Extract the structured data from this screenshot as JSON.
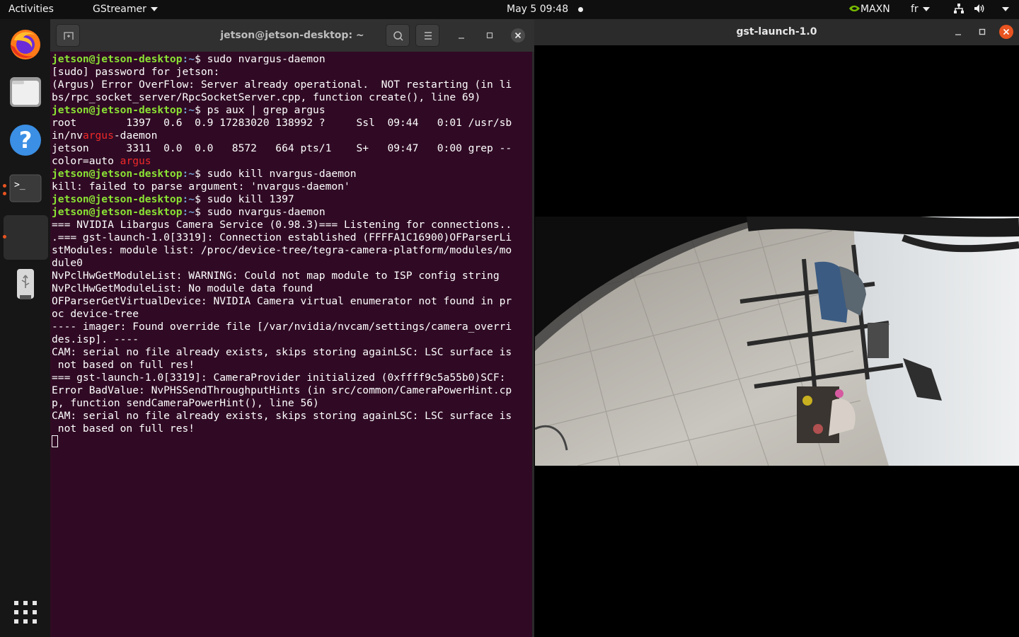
{
  "topbar": {
    "activities": "Activities",
    "app_menu": "GStreamer",
    "clock": "May 5  09:48",
    "power_mode": "MAXN",
    "keyboard_layout": "fr"
  },
  "dock": {
    "apps": [
      {
        "name": "Firefox",
        "icon": "firefox-icon"
      },
      {
        "name": "Files",
        "icon": "files-icon"
      },
      {
        "name": "Help",
        "icon": "help-icon"
      },
      {
        "name": "Terminal",
        "icon": "terminal-icon"
      },
      {
        "name": "GStreamer",
        "icon": "blank-app-icon"
      },
      {
        "name": "USB drive",
        "icon": "usb-drive-icon"
      }
    ],
    "show_apps_icon": "app-grid-icon"
  },
  "terminal": {
    "title": "jetson@jetson-desktop: ~",
    "prompt_user": "jetson@jetson-desktop",
    "prompt_path": ":~",
    "prompt_symbol": "$ ",
    "lines": [
      {
        "kind": "cmd",
        "text": "sudo nvargus-daemon"
      },
      {
        "kind": "out",
        "text": "[sudo] password for jetson:"
      },
      {
        "kind": "out",
        "text": "(Argus) Error OverFlow: Server already operational.  NOT restarting (in li"
      },
      {
        "kind": "out",
        "text": "bs/rpc_socket_server/RpcSocketServer.cpp, function create(), line 69)"
      },
      {
        "kind": "cmd",
        "text": "ps aux | grep argus"
      },
      {
        "kind": "out",
        "text": "root        1397  0.6  0.9 17283020 138992 ?     Ssl  09:44   0:01 /usr/sb"
      },
      {
        "kind": "hl",
        "pre": "in/nv",
        "hl": "argus",
        "post": "-daemon"
      },
      {
        "kind": "out",
        "text": "jetson      3311  0.0  0.0   8572   664 pts/1    S+   09:47   0:00 grep --"
      },
      {
        "kind": "hl",
        "pre": "color=auto ",
        "hl": "argus",
        "post": ""
      },
      {
        "kind": "cmd",
        "text": "sudo kill nvargus-daemon"
      },
      {
        "kind": "out",
        "text": "kill: failed to parse argument: 'nvargus-daemon'"
      },
      {
        "kind": "cmd",
        "text": "sudo kill 1397"
      },
      {
        "kind": "cmd",
        "text": "sudo nvargus-daemon"
      },
      {
        "kind": "out",
        "text": "=== NVIDIA Libargus Camera Service (0.98.3)=== Listening for connections.."
      },
      {
        "kind": "out",
        "text": ".=== gst-launch-1.0[3319]: Connection established (FFFFA1C16900)OFParserLi"
      },
      {
        "kind": "out",
        "text": "stModules: module list: /proc/device-tree/tegra-camera-platform/modules/mo"
      },
      {
        "kind": "out",
        "text": "dule0"
      },
      {
        "kind": "out",
        "text": "NvPclHwGetModuleList: WARNING: Could not map module to ISP config string"
      },
      {
        "kind": "out",
        "text": "NvPclHwGetModuleList: No module data found"
      },
      {
        "kind": "out",
        "text": "OFParserGetVirtualDevice: NVIDIA Camera virtual enumerator not found in pr"
      },
      {
        "kind": "out",
        "text": "oc device-tree"
      },
      {
        "kind": "out",
        "text": "---- imager: Found override file [/var/nvidia/nvcam/settings/camera_overri"
      },
      {
        "kind": "out",
        "text": "des.isp]. ----"
      },
      {
        "kind": "out",
        "text": "CAM: serial no file already exists, skips storing againLSC: LSC surface is"
      },
      {
        "kind": "out",
        "text": " not based on full res!"
      },
      {
        "kind": "out",
        "text": "=== gst-launch-1.0[3319]: CameraProvider initialized (0xffff9c5a55b0)SCF:"
      },
      {
        "kind": "out",
        "text": "Error BadValue: NvPHSSendThroughputHints (in src/common/CameraPowerHint.cp"
      },
      {
        "kind": "out",
        "text": "p, function sendCameraPowerHint(), line 56)"
      },
      {
        "kind": "out",
        "text": "CAM: serial no file already exists, skips storing againLSC: LSC surface is"
      },
      {
        "kind": "out",
        "text": " not based on full res!"
      }
    ]
  },
  "gst_window": {
    "title": "gst-launch-1.0"
  },
  "colors": {
    "terminal_bg": "#300a24",
    "prompt_green": "#8ae234",
    "path_blue": "#729fcf",
    "grep_highlight": "#ef2929",
    "close_button": "#e95420",
    "nvidia_green": "#76b900"
  }
}
